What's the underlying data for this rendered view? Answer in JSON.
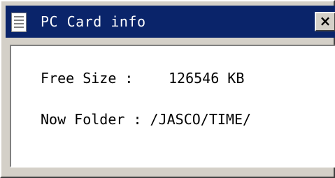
{
  "window": {
    "title": "PC Card info",
    "close_label": "×"
  },
  "info": {
    "free_size_label": "Free Size :",
    "free_size_value": "126546 KB",
    "now_folder_label": "Now Folder :",
    "now_folder_value": "/JASCO/TIME/"
  },
  "colors": {
    "titlebar": "#0a246a",
    "window_face": "#d4d0c8",
    "content_background": "#ffffff"
  },
  "icons": {
    "app": "document-icon",
    "close": "close-icon"
  }
}
